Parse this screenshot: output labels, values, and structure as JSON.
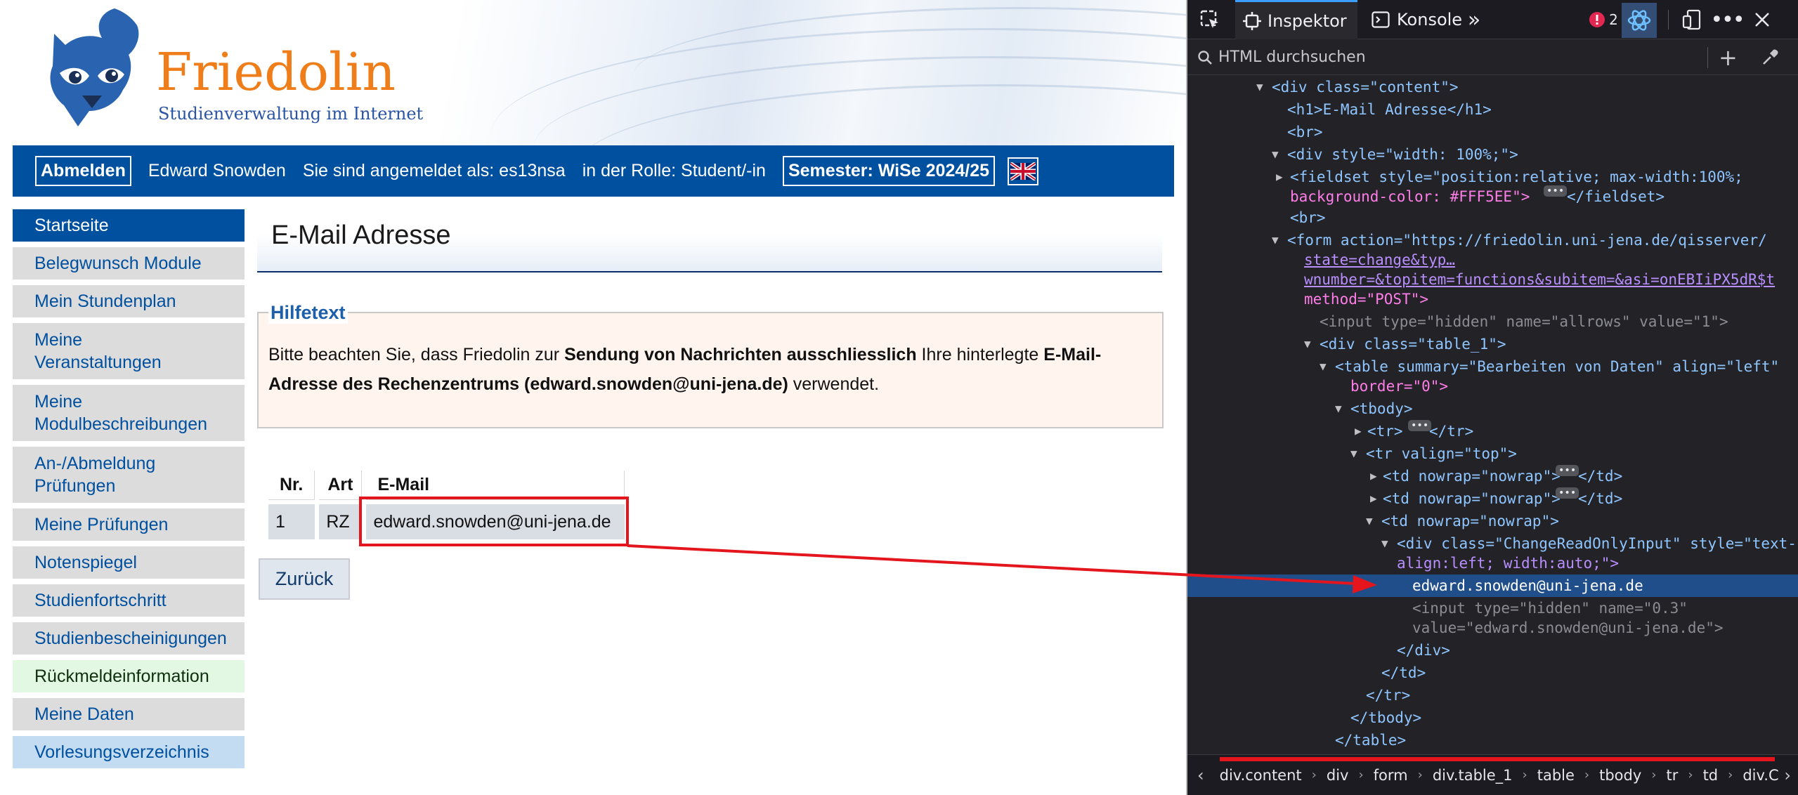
{
  "banner": {
    "brand_name": "Friedolin",
    "brand_subtitle": "Studienverwaltung im Internet"
  },
  "topbar": {
    "logout_label": "Abmelden",
    "user_name": "Edward Snowden",
    "logged_in_as": "Sie sind angemeldet als: es13nsa",
    "role": "in der Rolle: Student/-in",
    "semester": "Semester: WiSe 2024/25"
  },
  "sidebar": {
    "items": [
      {
        "label": "Startseite"
      },
      {
        "label": "Belegwunsch Module"
      },
      {
        "label": "Mein Stundenplan"
      },
      {
        "label": "Meine Veranstaltungen"
      },
      {
        "label": "Meine Modulbeschreibungen"
      },
      {
        "label": "An-/Abmeldung Prüfungen"
      },
      {
        "label": "Meine Prüfungen"
      },
      {
        "label": "Notenspiegel"
      },
      {
        "label": "Studienfortschritt"
      },
      {
        "label": "Studienbescheinigungen"
      },
      {
        "label": "Rückmeldeinformation"
      },
      {
        "label": "Meine Daten"
      },
      {
        "label": "Vorlesungsverzeichnis"
      }
    ]
  },
  "main": {
    "title": "E-Mail Adresse",
    "help": {
      "legend": "Hilfetext",
      "text_1": "Bitte beachten Sie, dass Friedolin zur ",
      "bold_1": "Sendung von Nachrichten ausschliesslich",
      "text_2": " Ihre hinterlegte ",
      "bold_2": "E-Mail-Adresse des Rechenzentrums (edward.snowden@uni-jena.de)",
      "text_3": " verwendet."
    },
    "table": {
      "headers": [
        "Nr.",
        "Art",
        "E-Mail"
      ],
      "rows": [
        [
          "1",
          "RZ",
          "edward.snowden@uni-jena.de"
        ]
      ]
    },
    "back_label": "Zurück"
  },
  "devtools": {
    "tabs": {
      "inspector": "Inspektor",
      "console": "Konsole"
    },
    "error_count": "2",
    "search_placeholder": "HTML durchsuchen",
    "tree": [
      "<div class=\"content\">",
      "<h1>E-Mail Adresse</h1>",
      "<br>",
      "<div style=\"width: 100%;\">",
      "<fieldset style=\"position:relative; max-width:100%;",
      "background-color: #FFF5EE\">",
      "</fieldset>",
      "<br>",
      "<form action=\"https://friedolin.uni-jena.de/qisserver/",
      "state=change&typ…",
      "wnumber=&topitem=functions&subitem=&asi=onEBIiPX5dR$t",
      "method=\"POST\">",
      "<input type=\"hidden\" name=\"allrows\" value=\"1\">",
      "<div class=\"table_1\">",
      "<table summary=\"Bearbeiten von Daten\" align=\"left\"",
      "border=\"0\">",
      "<tbody>",
      "<tr>",
      "</tr>",
      "<tr valign=\"top\">",
      "<td nowrap=\"nowrap\">",
      "</td>",
      "<td nowrap=\"nowrap\">",
      "</td>",
      "<td nowrap=\"nowrap\">",
      "<div class=\"ChangeReadOnlyInput\" style=\"text-",
      "align:left; width:auto;\">",
      "edward.snowden@uni-jena.de",
      "<input type=\"hidden\" name=\"0.3\"",
      "value=\"edward.snowden@uni-jena.de\">",
      "</div>",
      "</td>",
      "</tr>",
      "</tbody>",
      "</table>"
    ],
    "breadcrumbs": [
      "div.content",
      "div",
      "form",
      "div.table_1",
      "table",
      "tbody",
      "tr",
      "td",
      "div.C"
    ]
  }
}
